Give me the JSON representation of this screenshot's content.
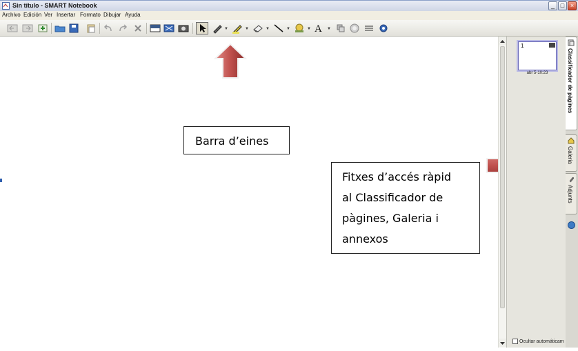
{
  "window": {
    "title": "Sin título - SMART Notebook",
    "minimize": "_",
    "maximize": "□",
    "close": "×"
  },
  "menu": [
    "Archivo",
    "Edición",
    "Ver",
    "Insertar",
    "Formato",
    "Dibujar",
    "Ayuda"
  ],
  "toolbar": {
    "buttons": [
      "back-icon",
      "forward-icon",
      "add-page-icon",
      "open-icon",
      "save-icon",
      "paste-icon",
      "undo-icon",
      "redo-icon",
      "delete-icon",
      "screen-shade-icon",
      "full-screen-icon",
      "capture-icon",
      "select-icon",
      "pen-icon",
      "highlighter-icon",
      "eraser-icon",
      "line-icon",
      "shape-icon",
      "text-icon",
      "table-icon",
      "fill-icon",
      "properties-icon",
      "help-icon"
    ],
    "text_tool_glyph": "A"
  },
  "sidebar": {
    "page_number": "1",
    "page_label": "abr 5-10:23",
    "autohide_label": "Ocultar automáticam"
  },
  "tabs": [
    {
      "label": "Classificador de pàgines",
      "icon": "page-sorter-icon",
      "active": true
    },
    {
      "label": "Galeria",
      "icon": "gallery-icon",
      "active": false
    },
    {
      "label": "Adjunts",
      "icon": "attachments-icon",
      "active": false
    }
  ],
  "callouts": {
    "toolbar": "Barra d’eines",
    "quick_tabs_lines": [
      "Fitxes d’accés ràpid",
      "al Classificador de",
      "pàgines, Galeria i",
      "annexos"
    ]
  },
  "colors": {
    "arrow_red": "#c0504d",
    "selection_border": "#6a6ab8"
  }
}
